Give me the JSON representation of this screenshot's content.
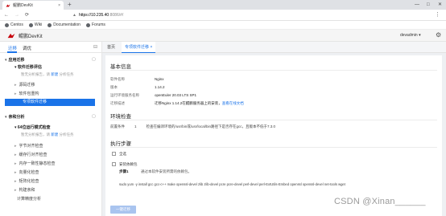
{
  "browser": {
    "tab_title": "鲲鹏DevKit",
    "tab_close": "×",
    "new_tab": "+",
    "window_controls": [
      "—",
      "□",
      "✕"
    ],
    "nav": [
      "←",
      "→",
      "⟳"
    ],
    "lock": "▲",
    "url_host": "https://10.235.40",
    "url_path": ":8086/#/",
    "menu": "⋮",
    "bookmarks": [
      "Centos",
      "Wiki",
      "Documentation",
      "Forums"
    ]
  },
  "app": {
    "brand": "鲲鹏DevKit",
    "user": "devadmin ▾",
    "settings_icon": "⚙"
  },
  "sidebar": {
    "tabs": [
      "迁移",
      "调优"
    ],
    "collapse": "⊟",
    "groups": [
      {
        "title": "应用迁移",
        "tool": "▢",
        "sub_title": "软件迁移评估",
        "hint_pre": "暂无分析报告，请 ",
        "hint_link": "新建",
        "hint_post": " 分析任务",
        "items": [
          "源码迁移",
          "软件包重构",
          "专项软件迁移"
        ],
        "active_item": 2
      },
      {
        "title": "亲和分析",
        "tool": "▢",
        "sub_title": "64位运行模式检查",
        "hint_pre": "暂无分析报告，请 ",
        "hint_link": "新建",
        "hint_post": " 分析任务",
        "items": [
          "字节对齐检查",
          "缓存行对齐检查",
          "内存一致性静态检查",
          "向量化检查",
          "矩阵化检查",
          "构建亲和",
          "计算精度分析"
        ]
      }
    ]
  },
  "main": {
    "page_tabs": [
      "首页",
      "专项软件迁移 ×"
    ],
    "active_tab": 1,
    "basic": {
      "title": "基本信息",
      "fields": [
        {
          "label": "软件名称",
          "value": "Nginx"
        },
        {
          "label": "版本",
          "value": "1.14.2"
        },
        {
          "label": "运行环境服务名称",
          "value": "openEuler 20.03 LTS SP1"
        },
        {
          "label": "迁移描述",
          "value": "迁移Nginx 1.14.2在鲲鹏服务器上的安装，",
          "link": "查看在线文档"
        }
      ]
    },
    "env": {
      "title": "环境检查",
      "label": "前置条件",
      "num": "1",
      "text": "检查在编译环境的/usr/bin或/usr/local/bin路径下是否存在gcc，且版本不低于7.3.0"
    },
    "exec": {
      "title": "执行步骤",
      "check_all": "全选",
      "install_dep": "安装依赖包",
      "step_label": "步骤1",
      "step_desc": "通过本软件安装所需的依赖包。",
      "command": "sudo yum -y install gcc gcc-c++ make openssl-devel zlib zlib-devel pcre pcre-devel perl-devel perl-ExtUtils-Embed openssl openssl-devel net-tools wget",
      "run_button": "一键迁移"
    }
  },
  "watermark": "CSDN @Xinan______"
}
